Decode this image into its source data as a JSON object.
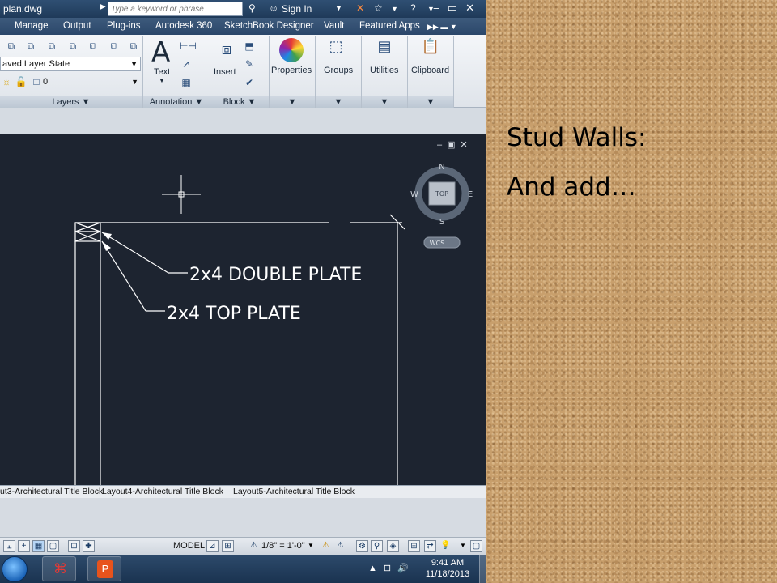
{
  "slide": {
    "heading": "Stud Walls:",
    "subtext": "And add…"
  },
  "app": {
    "file_name": "plan.dwg",
    "search_placeholder": "Type a keyword or phrase",
    "sign_in": "Sign In"
  },
  "ribbon_tabs": [
    "Manage",
    "Output",
    "Plug-ins",
    "Autodesk 360",
    "SketchBook Designer",
    "Vault",
    "Featured Apps"
  ],
  "ribbon": {
    "layer_state": "aved Layer State",
    "current_layer": "0",
    "panels": {
      "layers": "Layers",
      "annotation": "Annotation",
      "block": "Block"
    },
    "buttons": {
      "text": "Text",
      "insert": "Insert",
      "properties": "Properties",
      "groups": "Groups",
      "utilities": "Utilities",
      "clipboard": "Clipboard"
    }
  },
  "drawing": {
    "annotation_1": "2x4 DOUBLE PLATE",
    "annotation_2": "2x4 TOP PLATE",
    "viewcube": {
      "north": "N",
      "south": "S",
      "east": "E",
      "west": "W",
      "face": "TOP",
      "ucs": "WCS"
    }
  },
  "layout_tabs": [
    "ut3-Architectural Title Block",
    "Layout4-Architectural Title Block",
    "Layout5-Architectural Title Block"
  ],
  "status": {
    "space": "MODEL",
    "scale": "1/8\" = 1'-0\""
  },
  "taskbar": {
    "time": "9:41 AM",
    "date": "11/18/2013"
  },
  "colors": {
    "canvas": "#1d2430",
    "linework": "#ffffff",
    "ribbon_tab_bar": "#2b476a",
    "cork": "#c89f6c"
  }
}
